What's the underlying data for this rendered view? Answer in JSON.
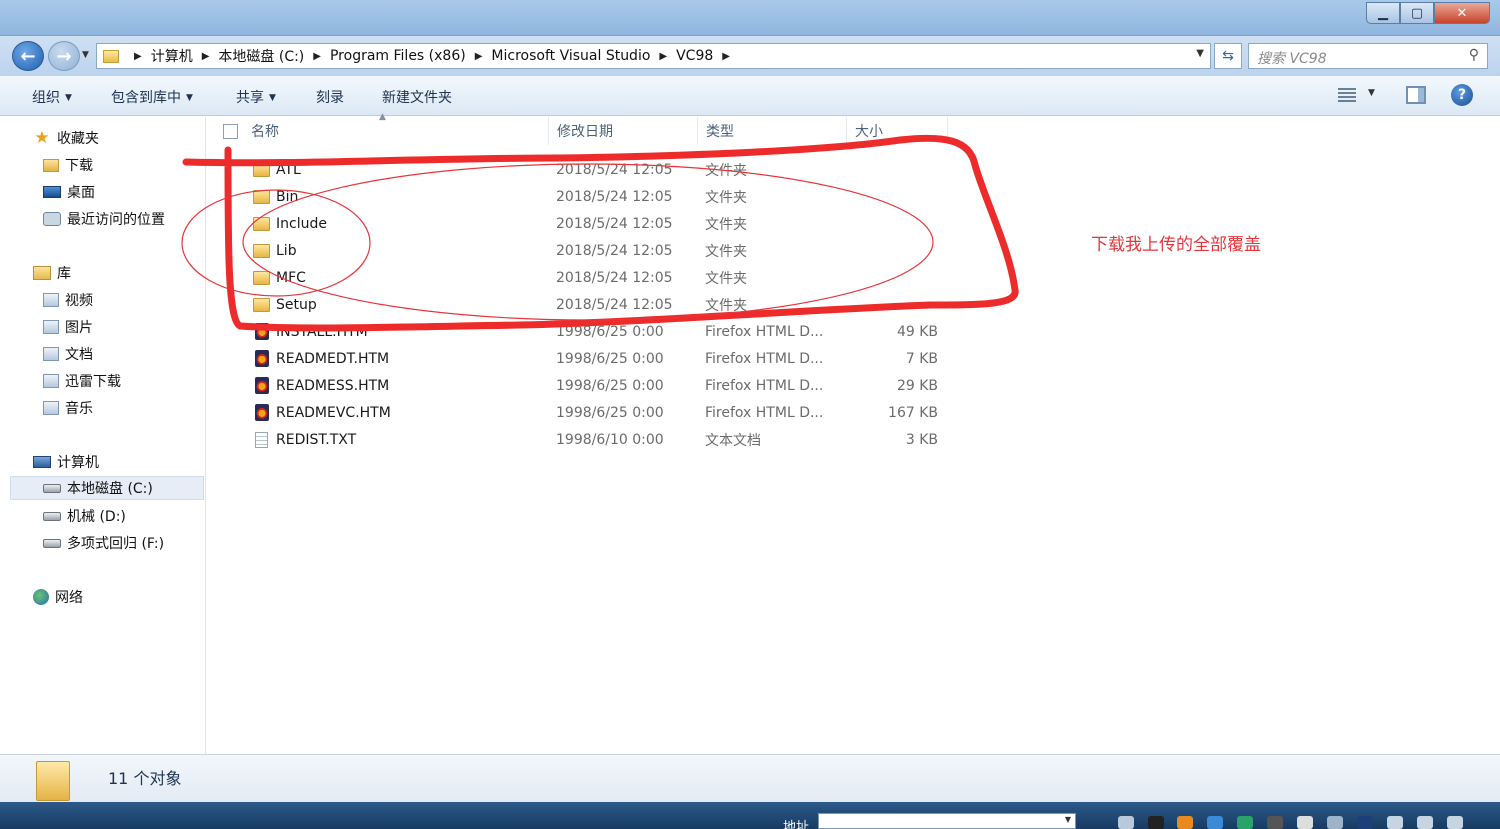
{
  "window": {
    "minimize_glyph": "▁",
    "maximize_glyph": "▢",
    "close_glyph": "✕"
  },
  "address": {
    "breadcrumbs": [
      "计算机",
      "本地磁盘 (C:)",
      "Program Files (x86)",
      "Microsoft Visual Studio",
      "VC98"
    ],
    "search_placeholder": "搜索 VC98"
  },
  "toolbar": {
    "organize": "组织",
    "include_in_library": "包含到库中",
    "share": "共享",
    "burn": "刻录",
    "new_folder": "新建文件夹"
  },
  "navigation": {
    "favorites": {
      "label": "收藏夹",
      "items": [
        "下载",
        "桌面",
        "最近访问的位置"
      ]
    },
    "libraries": {
      "label": "库",
      "items": [
        "视频",
        "图片",
        "文档",
        "迅雷下载",
        "音乐"
      ]
    },
    "computer": {
      "label": "计算机",
      "items": [
        "本地磁盘 (C:)",
        "机械 (D:)",
        "多项式回归 (F:)"
      ],
      "selected": "本地磁盘 (C:)"
    },
    "network": {
      "label": "网络"
    }
  },
  "columns": {
    "name": "名称",
    "modified": "修改日期",
    "type": "类型",
    "size": "大小"
  },
  "files": [
    {
      "name": "ATL",
      "date": "2018/5/24 12:05",
      "type": "文件夹",
      "size": "",
      "icon": "folder-icon"
    },
    {
      "name": "Bin",
      "date": "2018/5/24 12:05",
      "type": "文件夹",
      "size": "",
      "icon": "folder-icon"
    },
    {
      "name": "Include",
      "date": "2018/5/24 12:05",
      "type": "文件夹",
      "size": "",
      "icon": "folder-icon"
    },
    {
      "name": "Lib",
      "date": "2018/5/24 12:05",
      "type": "文件夹",
      "size": "",
      "icon": "folder-icon"
    },
    {
      "name": "MFC",
      "date": "2018/5/24 12:05",
      "type": "文件夹",
      "size": "",
      "icon": "folder-icon"
    },
    {
      "name": "Setup",
      "date": "2018/5/24 12:05",
      "type": "文件夹",
      "size": "",
      "icon": "folder-icon"
    },
    {
      "name": "INSTALL.HTM",
      "date": "1998/6/25 0:00",
      "type": "Firefox HTML D...",
      "size": "49 KB",
      "icon": "firefox-html-icon"
    },
    {
      "name": "READMEDT.HTM",
      "date": "1998/6/25 0:00",
      "type": "Firefox HTML D...",
      "size": "7 KB",
      "icon": "firefox-html-icon"
    },
    {
      "name": "READMESS.HTM",
      "date": "1998/6/25 0:00",
      "type": "Firefox HTML D...",
      "size": "29 KB",
      "icon": "firefox-html-icon"
    },
    {
      "name": "READMEVC.HTM",
      "date": "1998/6/25 0:00",
      "type": "Firefox HTML D...",
      "size": "167 KB",
      "icon": "firefox-html-icon"
    },
    {
      "name": "REDIST.TXT",
      "date": "1998/6/10 0:00",
      "type": "文本文档",
      "size": "3 KB",
      "icon": "text-document-icon"
    }
  ],
  "annotation": {
    "text": "下载我上传的全部覆盖",
    "color": "#e8343a"
  },
  "status": {
    "item_count": "11 个对象"
  },
  "taskbar": {
    "address_label": "地址"
  }
}
